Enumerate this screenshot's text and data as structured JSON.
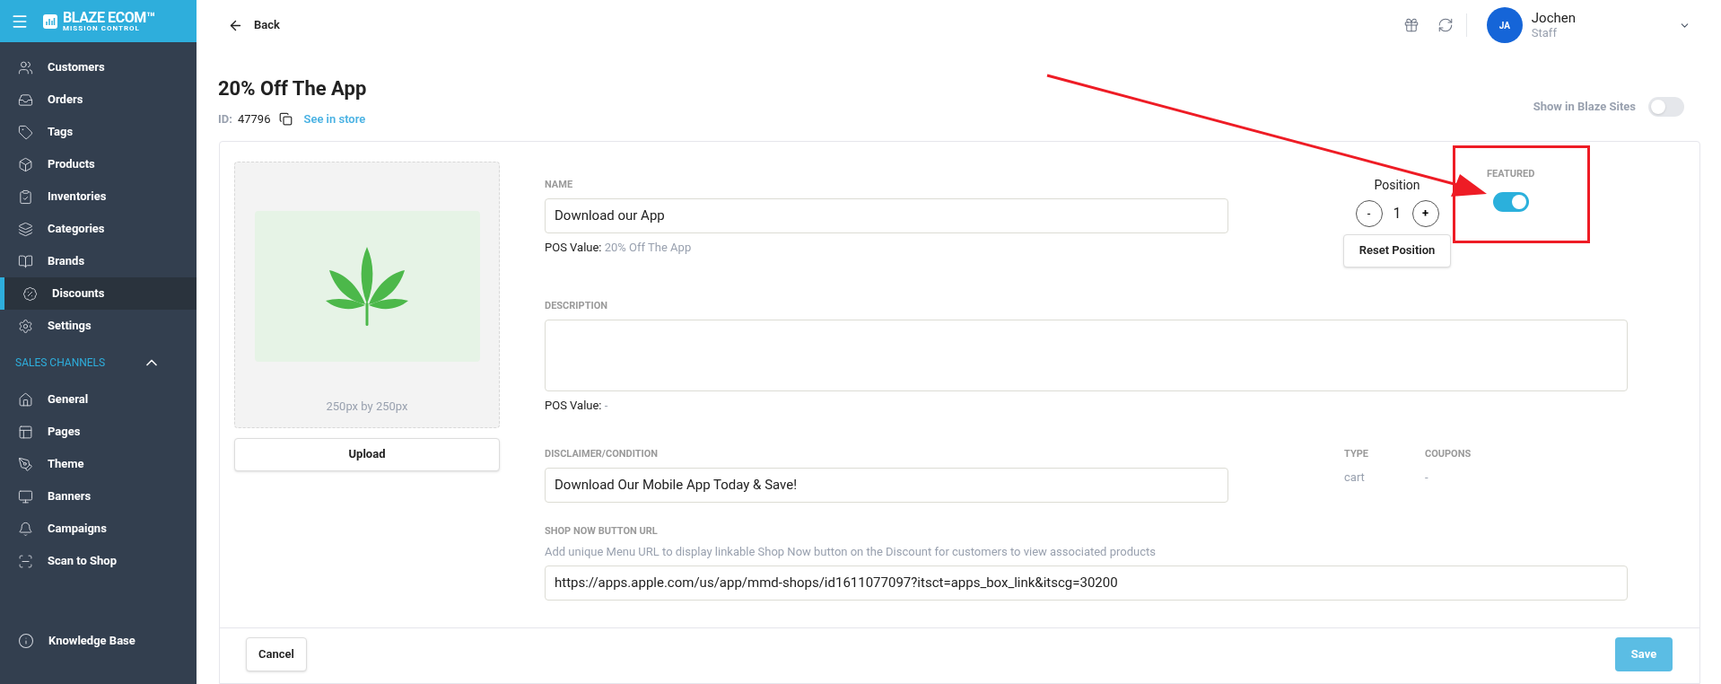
{
  "sidebar": {
    "brand": "BLAZE ECOM™",
    "tagline": "MISSION CONTROL",
    "items": [
      {
        "label": "Customers",
        "selected": false
      },
      {
        "label": "Orders",
        "selected": false
      },
      {
        "label": "Tags",
        "selected": false
      },
      {
        "label": "Products",
        "selected": false
      },
      {
        "label": "Inventories",
        "selected": false
      },
      {
        "label": "Categories",
        "selected": false
      },
      {
        "label": "Brands",
        "selected": false
      },
      {
        "label": "Discounts",
        "selected": true
      },
      {
        "label": "Settings",
        "selected": false
      }
    ],
    "section": {
      "label": "SALES CHANNELS",
      "expanded": true,
      "items": [
        {
          "label": "General",
          "selected": false
        },
        {
          "label": "Pages",
          "selected": false
        },
        {
          "label": "Theme",
          "selected": false
        },
        {
          "label": "Banners",
          "selected": false
        },
        {
          "label": "Campaigns",
          "selected": false
        },
        {
          "label": "Scan to Shop",
          "selected": false
        }
      ]
    },
    "footer_item": {
      "label": "Knowledge Base"
    }
  },
  "header": {
    "back": "Back",
    "user": {
      "initials": "JA",
      "name": "Jochen",
      "role": "Staff"
    }
  },
  "discount": {
    "title": "20% Off The App",
    "id_label": "ID:",
    "id": "47796",
    "store_link": "See in store",
    "show_in_sites": {
      "label": "Show in Blaze Sites",
      "on": false
    }
  },
  "image": {
    "caption": "250px by 250px",
    "upload": "Upload"
  },
  "form": {
    "name": {
      "label": "NAME",
      "value": "Download our App",
      "pos_label": "POS Value:",
      "pos_value": "20% Off The App"
    },
    "description": {
      "label": "DESCRIPTION",
      "pos_label": "POS Value:",
      "pos_value": "-"
    },
    "disclaimer": {
      "label": "DISCLAIMER/CONDITION",
      "value": "Download Our Mobile App Today & Save!"
    },
    "shop_url": {
      "label": "SHOP NOW BUTTON URL",
      "help": "Add unique Menu URL to display linkable Shop Now button on the Discount for customers to view associated products",
      "value": "https://apps.apple.com/us/app/mmd-shops/id1611077097?itsct=apps_box_link&itscg=30200"
    }
  },
  "position": {
    "label": "Position",
    "value": "1",
    "decrement": "-",
    "increment": "+",
    "reset": "Reset Position"
  },
  "featured": {
    "label": "FEATURED",
    "on": true
  },
  "meta": [
    {
      "label": "TYPE",
      "value": "cart"
    },
    {
      "label": "COUPONS",
      "value": "-"
    }
  ],
  "actions": {
    "cancel": "Cancel",
    "save": "Save"
  }
}
